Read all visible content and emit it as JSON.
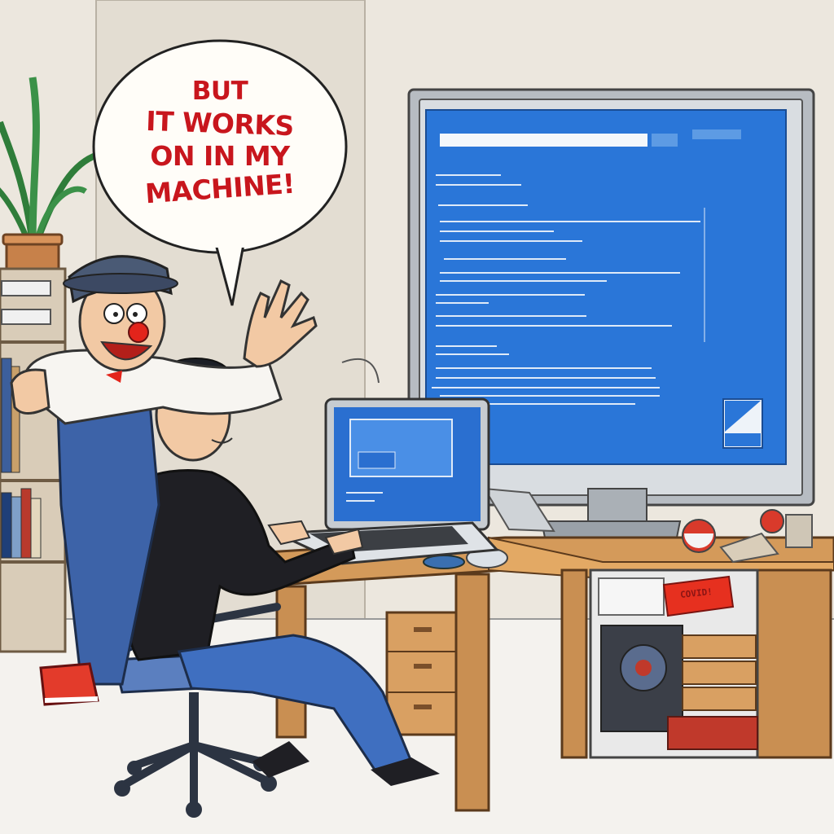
{
  "speech_bubble": {
    "lines": [
      "BUT",
      "IT WORKS",
      "ON IN MY",
      "MACHINE!"
    ]
  },
  "sticker": {
    "text": "COVID!"
  },
  "colors": {
    "bubble_text": "#c8161d",
    "screen_blue": "#2a76d8",
    "desk": "#c98f52",
    "wall": "#efebe3"
  },
  "icons": [
    "potted-plant",
    "bookshelf",
    "monitor",
    "laptop",
    "office-chair",
    "mouse",
    "desk",
    "drawer-cabinet",
    "pc-tower"
  ]
}
